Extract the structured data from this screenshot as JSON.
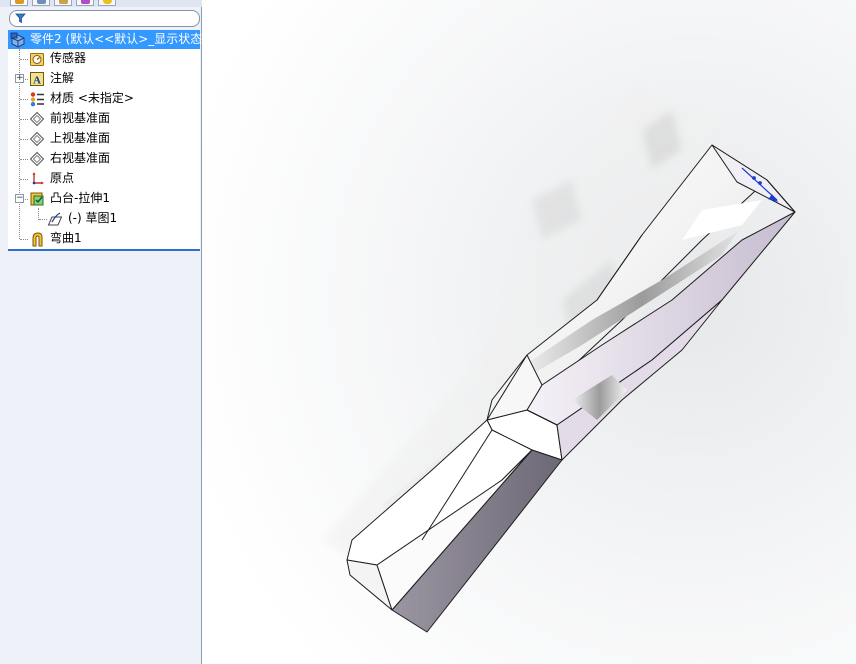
{
  "panel_tabs": [
    {
      "name": "feature-manager-tab",
      "active": true,
      "color": "#d89b1e"
    },
    {
      "name": "property-manager-tab",
      "active": false,
      "color": "#6f8fb8"
    },
    {
      "name": "configuration-manager-tab",
      "active": false,
      "color": "#caa24a"
    },
    {
      "name": "dimxpert-tab",
      "active": false,
      "color": "#b04fc4"
    },
    {
      "name": "display-manager-tab",
      "active": false,
      "color": "#e8c21c"
    }
  ],
  "filter": {
    "placeholder": "",
    "icon": "filter-icon"
  },
  "tree": {
    "root": {
      "label": "零件2 (默认<<默认>_显示状态",
      "icon": "part-icon",
      "selected": true
    },
    "items": [
      {
        "name": "sensors",
        "label": "传感器",
        "icon": "sensor-icon",
        "expandable": false
      },
      {
        "name": "annotations",
        "label": "注解",
        "icon": "annotation-icon",
        "expandable": true,
        "expanded": false
      },
      {
        "name": "material",
        "label": "材质 <未指定>",
        "icon": "material-icon",
        "expandable": false
      },
      {
        "name": "front-plane",
        "label": "前视基准面",
        "icon": "plane-icon",
        "expandable": false
      },
      {
        "name": "top-plane",
        "label": "上视基准面",
        "icon": "plane-icon",
        "expandable": false
      },
      {
        "name": "right-plane",
        "label": "右视基准面",
        "icon": "plane-icon",
        "expandable": false
      },
      {
        "name": "origin",
        "label": "原点",
        "icon": "origin-icon",
        "expandable": false
      },
      {
        "name": "boss-extrude",
        "label": "凸台-拉伸1",
        "icon": "extrude-icon",
        "expandable": true,
        "expanded": true
      },
      {
        "name": "sketch1",
        "label": "(-) 草图1",
        "icon": "sketch-icon",
        "expandable": false,
        "child": true
      },
      {
        "name": "flex1",
        "label": "弯曲1",
        "icon": "flex-icon",
        "expandable": false
      }
    ]
  },
  "colors": {
    "selection": "#3399ff",
    "panel_bg": "#eef1f8",
    "model_face_light": "#ffffff",
    "model_face_dark": "#857f8c",
    "model_face_tint": "#e4dbe8"
  }
}
